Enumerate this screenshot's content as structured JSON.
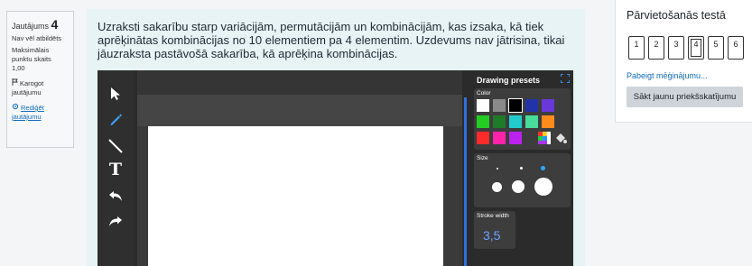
{
  "question_info": {
    "label": "Jautājums",
    "number": "4",
    "status": "Nav vēl atbildēts",
    "max_points_label": "Maksimālais punktu skaits",
    "max_points_value": "1,00",
    "flag_label": "Karogot jautājumu",
    "edit_label": "Rediģēt jautājumu"
  },
  "question": {
    "text": "Uzraksti sakarību starp variācijām, permutācijām un kombinācijām, kas izsaka, kā tiek aprēķinātas kombinācijas no 10 elementiem pa 4 elementim. Uzdevums nav jātrisina, tikai jāuzraksta pastāvošā sakarība, kā aprēķina kombinācijas."
  },
  "drawing": {
    "presets_title": "Drawing presets",
    "color_label": "Color",
    "size_label": "Size",
    "stroke_label": "Stroke width",
    "stroke_value": "3,5",
    "tools": [
      "pointer-icon",
      "pencil-icon",
      "line-icon",
      "text-icon",
      "undo-icon",
      "redo-icon"
    ],
    "text_tool_glyph": "T",
    "colors": [
      "#ffffff",
      "#8a8a8a",
      "#000000",
      "#2233aa",
      "#6a38d8",
      "#22cc22",
      "#1f7a2a",
      "#22cccc",
      "#48dd99",
      "#ff8c1a",
      "#ff2a2a",
      "#ff22aa",
      "#bb22ee"
    ]
  },
  "navigation": {
    "title": "Pārvietošanās testā",
    "pages": [
      "1",
      "2",
      "3",
      "4",
      "5",
      "6"
    ],
    "current_page": "4",
    "finish_link": "Pabeigt mēģinājumu...",
    "new_preview_button": "Sākt jaunu priekšskatījumu"
  }
}
